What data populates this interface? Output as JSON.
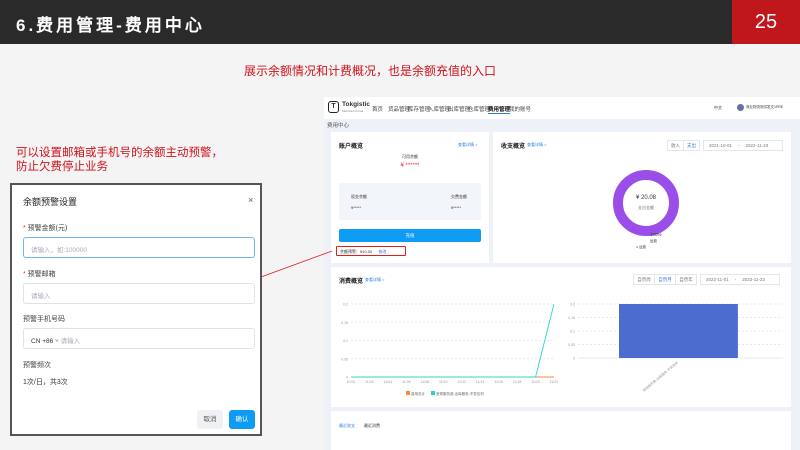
{
  "slide": {
    "title": "6.费用管理-费用中心",
    "page_number": "25",
    "subtitle": "展示余额情况和计费概况，也是余额充值的入口",
    "note_line1": "可以设置邮箱或手机号的余额主动预警，",
    "note_line2": "防止欠费停止业务"
  },
  "app": {
    "logo": "Tokgistic",
    "logo_sub": "Merchant Portal",
    "nav": [
      "首页",
      "货品管理",
      "库存管理",
      "入库管理",
      "出库管理",
      "仓库管理",
      "费用管理",
      "我的账号"
    ],
    "active_nav": 6,
    "lang": "中文",
    "user": "商业物流测试发文1PRE",
    "page_title": "费用中心",
    "account": {
      "title": "账户概览",
      "detail": "查看详情 >",
      "available_label": "可用余额",
      "available_value": "¥ ******",
      "cash_label": "现金余额",
      "cash_value": "¥*****",
      "credit_label": "欠费金额",
      "credit_value": "¥*****",
      "recharge": "充值",
      "alert_label": "余额预警：¥10.00",
      "alert_edit": "修改"
    },
    "income": {
      "title": "收支概览",
      "detail": "查看详情 >",
      "tabs": [
        "收入",
        "支出"
      ],
      "active_tab": 1,
      "date_from": "2021-10-01",
      "date_to": "2022-11-23",
      "center_value": "¥ 20.08",
      "center_label": "支出金额",
      "pct": "100%",
      "pct_label": "运费",
      "legend": "运费",
      "color": "#9b4de8"
    },
    "consumption": {
      "title": "消费概览",
      "detail": "查看详情 >",
      "tabs": [
        "自然周",
        "自然月",
        "自然年"
      ],
      "active_tab": 1,
      "date_from": "2022-11-01",
      "date_to": "2022-11-23",
      "legend": [
        "费用总计",
        "常规服务费-出库服务-不发包材"
      ]
    },
    "bottom_tabs": [
      "最近收支",
      "最近消费"
    ]
  },
  "modal": {
    "title": "余额预警设置",
    "close": "×",
    "amount_label": "预警金额(元)",
    "amount_placeholder": "请输入，如:100000",
    "email_label": "预警邮箱",
    "email_placeholder": "请输入",
    "phone_label": "预警手机号码",
    "country_code": "CN +86",
    "phone_placeholder": "请输入",
    "freq_label": "预警频次",
    "freq_value": "1次/日，共3次",
    "cancel": "取消",
    "confirm": "确认"
  },
  "chart_data": [
    {
      "type": "line",
      "x": [
        "10/31",
        "11/02",
        "11/04",
        "11/06",
        "11/08",
        "11/10",
        "11/12",
        "11/14",
        "11/16",
        "11/18",
        "11/20",
        "11/22"
      ],
      "series": [
        {
          "name": "费用总计",
          "color": "#f5894a",
          "values": [
            0,
            0,
            0,
            0,
            0,
            0,
            0,
            0,
            0,
            0,
            0,
            0
          ]
        },
        {
          "name": "常规服务费-出库服务-不发包材",
          "color": "#2ad6c8",
          "values": [
            0,
            0,
            0,
            0,
            0,
            0,
            0,
            0,
            0,
            0,
            0,
            0.2
          ]
        }
      ],
      "yticks": [
        "0",
        "0.05",
        "0.1",
        "0.15",
        "0.2"
      ],
      "ylim": [
        0,
        0.2
      ]
    },
    {
      "type": "bar",
      "categories": [
        "常规服务费-出库服务-不发包材"
      ],
      "values": [
        0.2
      ],
      "color": "#4c6ccf",
      "yticks": [
        "0",
        "0.05",
        "0.1",
        "0.15",
        "0.2"
      ],
      "ylim": [
        0,
        0.2
      ]
    }
  ]
}
